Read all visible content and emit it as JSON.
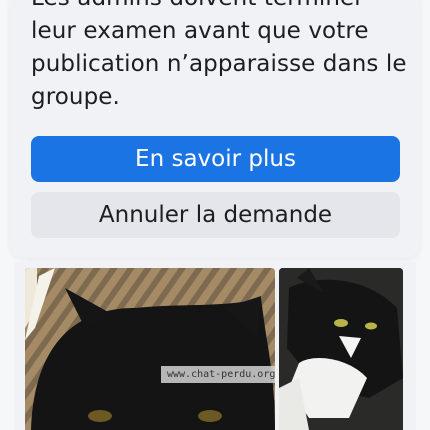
{
  "notice": {
    "text": "Les admins doivent terminer leur examen avant que votre publication n’apparaisse dans le groupe.",
    "primary_label": "En savoir plus",
    "secondary_label": "Annuler la demande"
  },
  "photos": {
    "watermark": "www.chat-perdu.org"
  },
  "colors": {
    "primary": "#1b74e4",
    "secondary": "#e4e6eb",
    "text": "#1c1e21"
  }
}
